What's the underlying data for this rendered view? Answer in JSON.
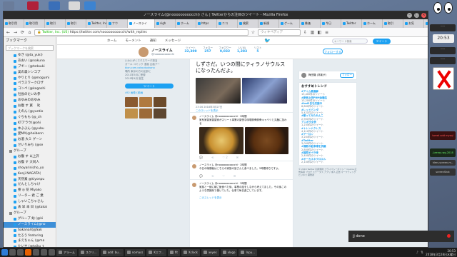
{
  "window": {
    "title": "ノースライム(@nooooooooocchi) さん | Twitterからの注目のツイート - Mozilla Firefox"
  },
  "tabs": [
    "取引用",
    "取引用",
    "取引",
    "取引",
    "Twitter, Inc. (us)",
    "ナウ",
    "ノースライ",
    "sigh",
    "ホーム",
    "https",
    "ニコ",
    "検索",
    "新規",
    "ゲーム",
    "株価",
    "今日",
    "Twitter",
    "ホーム",
    "取引",
    "お気",
    "設定",
    "取引"
  ],
  "nav": {
    "back_icon": "arrow-left-icon",
    "url_secure": "Twitter, Inc. (US)",
    "url": "https://twitter.com/nooooooooocchi/with_replies",
    "search_placeholder": "ウィキペディア",
    "menu_icon": "hamburger-menu-icon"
  },
  "sidebar": {
    "title": "ブックマーク",
    "search_placeholder": "ブックマークを検索",
    "items": [
      {
        "label": "ゆき (@ta_yuki)",
        "type": "link"
      },
      {
        "label": "あおい (@nakuna",
        "type": "link"
      },
      {
        "label": "ブギー (@tsdouki",
        "type": "link"
      },
      {
        "label": "美の森シンコプ",
        "type": "link"
      },
      {
        "label": "やりとり (@mogumi",
        "type": "link"
      },
      {
        "label": "ペラスワークロザ",
        "type": "link"
      },
      {
        "label": "コンペ (@kogoshi",
        "type": "link"
      },
      {
        "label": "社長のたいみ参",
        "type": "link"
      },
      {
        "label": "あゆみのあゆみ",
        "type": "link"
      },
      {
        "label": "お腹 す 買 　叱",
        "type": "link"
      },
      {
        "label": "えのん (@yuntio",
        "type": "link"
      },
      {
        "label": "ぐちもも (@_ch",
        "type": "link"
      },
      {
        "label": "KTアラウ(@ohi",
        "type": "link"
      },
      {
        "label": "ゆぶぶん (@yubu",
        "type": "link"
      },
      {
        "label": "愛MA(@heibenn",
        "type": "link"
      },
      {
        "label": "お酒 大ミ ゲーン",
        "type": "link"
      },
      {
        "label": "せいりみち (@se",
        "type": "link"
      },
      {
        "label": "グループ",
        "type": "folder"
      },
      {
        "label": "お腹 す 以上許",
        "type": "link"
      },
      {
        "label": "お腹 す 大同人",
        "type": "link"
      },
      {
        "label": "shoyarinicho_yo",
        "type": "link"
      },
      {
        "label": "Kenji NAGATA(",
        "type": "link"
      },
      {
        "label": "天然素 @kiyonpu",
        "type": "link"
      },
      {
        "label": "だんとしちゃけ",
        "type": "link"
      },
      {
        "label": "寮 ◎ 花 Miyako",
        "type": "link"
      },
      {
        "label": "リーター 君 ご 業",
        "type": "link"
      },
      {
        "label": "しゃいこちゃさん",
        "type": "link"
      },
      {
        "label": "表 早 本 日 (@takai",
        "type": "link"
      },
      {
        "label": "グループ",
        "type": "folder"
      },
      {
        "label": "グループ 幼 (@ki",
        "type": "link"
      },
      {
        "label": "ノースライム(@no",
        "type": "link"
      },
      {
        "label": "Sakana4(@Sak",
        "type": "link"
      },
      {
        "label": "たろう featuring",
        "type": "link"
      },
      {
        "label": "まえちゃん (@ma",
        "type": "link"
      },
      {
        "label": "たいや (@taiku_t",
        "type": "link"
      }
    ],
    "selected_index": 30
  },
  "twitter": {
    "nav": [
      "ホーム",
      "モーメント",
      "通知",
      "メッセージ"
    ],
    "search_placeholder": "キーワード検索",
    "tweet_button": "ツイート",
    "profile": {
      "name": "ノースライム",
      "handle": "@nooooooooocchi",
      "stats": [
        {
          "label": "ツイート",
          "value": "32,309"
        },
        {
          "label": "フォロー",
          "value": "257"
        },
        {
          "label": "フォロワー",
          "value": "9,032"
        },
        {
          "label": "いいね",
          "value": "1,283"
        },
        {
          "label": "リスト",
          "value": "5"
        }
      ],
      "follow_button": "フォローする"
    },
    "left": {
      "lines": [
        "いわいがくエクスワーク担当",
        "ガール コミック 漫画 企画アー",
        "bion.com.cokoutuokano",
        "場所 東京の方の区部に",
        "2011年5月に登録",
        "2019年4月 誕生"
      ],
      "tweet_button": "ツイート",
      "photos_label": "492 画像と動画"
    },
    "tweet1": {
      "text": "しずさだ。いつの間にティラノサウルスになったんだよ。",
      "time": "23:16 2018年3月27日",
      "reply_link": "このスレッドを表示"
    },
    "tweet2": {
      "header": "ノースライム @nooooooooocchi · 2時間",
      "body": "家系家豪家豪豪家がスリート事業の豪快な味噌豚骨豚骨キャベツと丸麺に加わる",
      "acts": [
        "💬",
        "⟲",
        "♡ 2",
        "✉"
      ]
    },
    "tweet3": {
      "header": "ノースライム @nooooooooocchi · 2時間",
      "body": "今日の晩御飯はこちらの家族の皆さんと食べました。2時間待ちですよ。",
      "acts": [
        "💬",
        "⟲",
        "♡",
        "✉"
      ]
    },
    "tweet4": {
      "header": "ノースライム @nooooooooocchi · 2時間",
      "body": "家族と一緒に朝ご飯食べた後、事業の話をしながら考えてました。その後このような雰囲気で働いていた。仕事で毎日過ごしています。",
      "more": "このスレッドを表示"
    },
    "right": {
      "user_suggest": "梅田隆 (邦楽が)",
      "user_suggest_btn": "フォロー",
      "trends_title": "おすすめトレンド",
      "trends": [
        {
          "t": "#アイム最適解",
          "s": "13,400件のツイート"
        },
        {
          "t": "#新宿上田PBM会議生",
          "s": "13,200件のツイート"
        },
        {
          "t": "#led3日を応援中",
          "s": "6,800件のツイート"
        },
        {
          "t": "#レッドパンダ",
          "s": "5,421件のツイート"
        },
        {
          "t": "#歌ってみたれんこ",
          "s": "2,901件のツイート"
        },
        {
          "t": "アニポタ女表",
          "s": "1,234件のツイート"
        },
        {
          "t": "#トレンドクレス",
          "s": "4,112件のツイート"
        },
        {
          "t": "#アーロン",
          "s": "3,204件のツイート"
        },
        {
          "t": "#Twitter",
          "s": "3,000件のツイート"
        },
        {
          "t": "#偶数の駐車場を抗議",
          "s": "2,800件のツイート"
        },
        {
          "t": "#国際オペラ寺",
          "s": "2,400件のツイート"
        },
        {
          "t": "#オーカスネクロエル",
          "s": "2,100件のツイート"
        }
      ],
      "footer": "© 2018 Twitter 利用規約 プライバシーポリシー Cookie 広告情報 ブログ ステータス アプリ 求人 広告 マーケティング ビジネス 開発者"
    }
  },
  "notification": {
    "text": "jj done"
  },
  "panel": {
    "clock_widget": "20:53",
    "widgets": [
      "-----",
      "-----",
      "-----",
      "tweet add mysql ura.s",
      "-Leeroy-wg-2018 2018/3",
      "hlms-screen-m--",
      "screenShot"
    ]
  },
  "taskbar": {
    "items": [
      "アラーム",
      "スクリ...",
      "add: bu...",
      "nomacs",
      "Kエフ...",
      "fit",
      "Xclock",
      "xeyes",
      "xlogo",
      "Inpu..."
    ],
    "clock": "20:53",
    "date": "2018年3月28日水曜日"
  },
  "colors": {
    "twitter_blue": "#1da1f2",
    "taskbar": "#1c1c1c",
    "selected": "#3d8fd8"
  }
}
